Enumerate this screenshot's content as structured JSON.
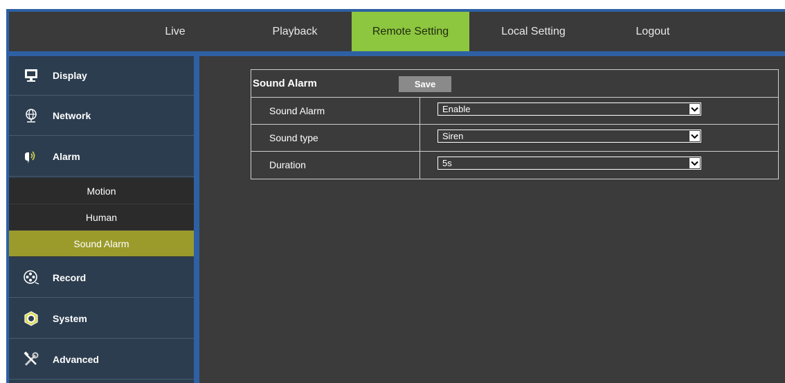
{
  "nav": {
    "items": [
      {
        "label": "Live"
      },
      {
        "label": "Playback"
      },
      {
        "label": "Remote Setting",
        "active": true
      },
      {
        "label": "Local Setting"
      },
      {
        "label": "Logout"
      }
    ]
  },
  "sidebar": {
    "items": [
      {
        "label": "Display",
        "icon": "monitor-icon"
      },
      {
        "label": "Network",
        "icon": "globe-network-icon"
      },
      {
        "label": "Alarm",
        "icon": "alarm-speaker-icon"
      },
      {
        "label": "Record",
        "icon": "film-reel-icon"
      },
      {
        "label": "System",
        "icon": "hex-nut-icon"
      },
      {
        "label": "Advanced",
        "icon": "tools-icon"
      }
    ],
    "alarm_sub": [
      {
        "label": "Motion"
      },
      {
        "label": "Human"
      },
      {
        "label": "Sound Alarm",
        "active": true
      }
    ]
  },
  "panel": {
    "title": "Sound Alarm",
    "save_label": "Save",
    "rows": [
      {
        "label": "Sound Alarm",
        "value": "Enable"
      },
      {
        "label": "Sound type",
        "value": "Siren"
      },
      {
        "label": "Duration",
        "value": "5s"
      }
    ]
  },
  "colors": {
    "frame_blue": "#2e61a4",
    "nav_active": "#8dc63f",
    "sub_active": "#9b9b2c",
    "sidebar_bg": "#2c3d4f",
    "content_bg": "#3b3b3b"
  }
}
